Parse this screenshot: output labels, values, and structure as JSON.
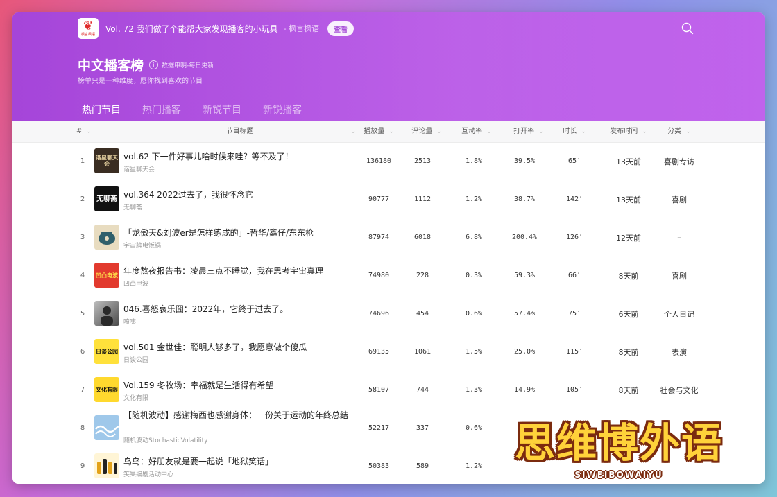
{
  "topbar": {
    "logo_text": "枫言枫语",
    "episode_link": "Vol. 72 我们做了个能帮大家发现播客的小玩具",
    "author": "- 枫言枫语",
    "view_button": "查看"
  },
  "page": {
    "title": "中文播客榜",
    "update_note": "数据申明-每日更新",
    "subtitle": "榜单只是一种维度，愿你找到喜欢的节目"
  },
  "tabs": [
    {
      "label": "热门节目",
      "active": true
    },
    {
      "label": "热门播客",
      "active": false
    },
    {
      "label": "新锐节目",
      "active": false
    },
    {
      "label": "新锐播客",
      "active": false
    }
  ],
  "table": {
    "headers": {
      "rank": "#",
      "title": "节目标题",
      "plays": "播放量",
      "comments": "评论量",
      "interaction": "互动率",
      "open_rate": "打开率",
      "duration": "时长",
      "published": "发布时间",
      "category": "分类"
    },
    "rows": [
      {
        "rank": "1",
        "title": "vol.62 下一件好事儿啥时候来哇？等不及了！",
        "podcast": "谐星聊天会",
        "cover_text": "谐星聊天会",
        "plays": "136180",
        "comments": "2513",
        "interaction": "1.8%",
        "open_rate": "39.5%",
        "duration": "65′",
        "published": "13天前",
        "category": "喜剧专访"
      },
      {
        "rank": "2",
        "title": "vol.364 2022过去了，我很怀念它",
        "podcast": "无聊斋",
        "cover_text": "无聊斋",
        "plays": "90777",
        "comments": "1112",
        "interaction": "1.2%",
        "open_rate": "38.7%",
        "duration": "142′",
        "published": "13天前",
        "category": "喜剧"
      },
      {
        "rank": "3",
        "title": "「龙傲天&刘波er是怎样练成的」-哲华/鑫仔/东东枪",
        "podcast": "宇宙牌电饭锅",
        "cover_text": "",
        "plays": "87974",
        "comments": "6018",
        "interaction": "6.8%",
        "open_rate": "200.4%",
        "duration": "126′",
        "published": "12天前",
        "category": "–"
      },
      {
        "rank": "4",
        "title": "年度熬夜报告书：凌晨三点不睡觉，我在思考宇宙真理",
        "podcast": "凹凸电波",
        "cover_text": "凹凸电波",
        "plays": "74980",
        "comments": "228",
        "interaction": "0.3%",
        "open_rate": "59.3%",
        "duration": "66′",
        "published": "8天前",
        "category": "喜剧"
      },
      {
        "rank": "5",
        "title": "046.喜怒哀乐囧：2022年，它终于过去了。",
        "podcast": "喷嚏",
        "cover_text": "",
        "plays": "74696",
        "comments": "454",
        "interaction": "0.6%",
        "open_rate": "57.4%",
        "duration": "75′",
        "published": "6天前",
        "category": "个人日记"
      },
      {
        "rank": "6",
        "title": "vol.501 金世佳：聪明人够多了，我愿意做个傻瓜",
        "podcast": "日谈公园",
        "cover_text": "日谈公园",
        "plays": "69135",
        "comments": "1061",
        "interaction": "1.5%",
        "open_rate": "25.0%",
        "duration": "115′",
        "published": "8天前",
        "category": "表演"
      },
      {
        "rank": "7",
        "title": "Vol.159 冬牧场：幸福就是生活得有希望",
        "podcast": "文化有限",
        "cover_text": "文化有限",
        "plays": "58107",
        "comments": "744",
        "interaction": "1.3%",
        "open_rate": "14.9%",
        "duration": "105′",
        "published": "8天前",
        "category": "社会与文化"
      },
      {
        "rank": "8",
        "title": "【随机波动】感谢梅西也感谢身体：一份关于运动的年终总结",
        "podcast": "随机波动StochasticVolatility",
        "cover_text": "",
        "plays": "52217",
        "comments": "337",
        "interaction": "0.6%",
        "open_rate": "",
        "duration": "",
        "published": "",
        "category": ""
      },
      {
        "rank": "9",
        "title": "鸟鸟：好朋友就是要一起说「地狱笑话」",
        "podcast": "笑果编剧活动中心",
        "cover_text": "",
        "plays": "50383",
        "comments": "589",
        "interaction": "1.2%",
        "open_rate": "",
        "duration": "",
        "published": "",
        "category": ""
      }
    ]
  },
  "watermark": {
    "main": "思维博外语",
    "sub": "SIWEIBOWAIYU"
  }
}
